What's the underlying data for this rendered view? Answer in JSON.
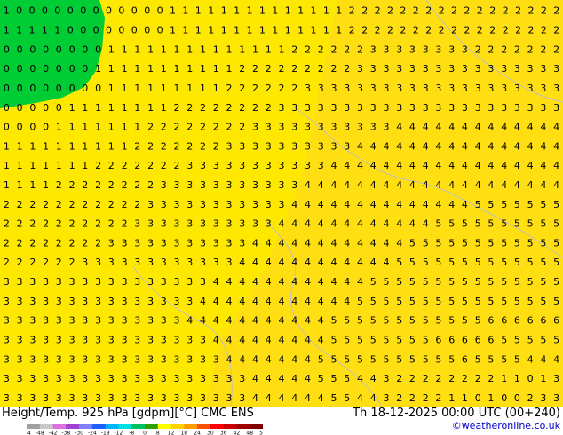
{
  "footer": {
    "title": "Height/Temp. 925 hPa [gdpm][°C] CMC ENS",
    "datetime": "Th 18-12-2025 00:00 UTC (00+240)",
    "credit": "©weatheronline.co.uk"
  },
  "legend": {
    "ticks": [
      "-54",
      "-48",
      "-42",
      "-38",
      "-30",
      "-24",
      "-18",
      "-12",
      "-8",
      "0",
      "8",
      "12",
      "18",
      "24",
      "30",
      "36",
      "42",
      "48",
      "54"
    ],
    "colors": [
      "#a0a0a0",
      "#c8c8c8",
      "#e070e0",
      "#a040d0",
      "#8080ff",
      "#2060ff",
      "#00b4ff",
      "#00e0e0",
      "#00c060",
      "#30a000",
      "#ffff00",
      "#ffd200",
      "#ff9a00",
      "#ff5000",
      "#ff0000",
      "#c80000",
      "#a00000",
      "#800000"
    ]
  },
  "map": {
    "colors": {
      "warm": "#ffe800",
      "warmer": "#ffdc1a",
      "cold": "#00cc33",
      "coast": "#c0c0c0"
    },
    "rows": [
      "1 0 0 0 0 0 0 0 0 0 0 0 0 1 1 1 1 1 1 1 1 1 1 1 1 1 1 2 2 2 2 2 2 2 2 2 2 2 2 2 2 2 2 2",
      "1 1 1 1 1 0 0 0 0 0 0 0 0 1 1 1 1 1 1 1 1 1 1 1 1 1 1 2 2 2 2 2 2 2 2 2 2 2 2 2 2 2 2 2",
      "0 0 0 0 0 0 0 0 1 1 1 1 1 1 1 1 1 1 1 1 1 1 2 2 2 2 2 2 3 3 3 3 3 3 3 3 2 2 2 2 2 2 2",
      "0 0 0 0 0 0 0 1 1 1 1 1 1 1 1 1 1 1 2 2 2 2 2 2 2 2 2 3 3 3 3 3 3 3 3 3 3 3 3 3 3 3 3",
      "0 0 0 0 0 0 0 0 1 1 1 1 1 1 1 1 1 2 2 2 2 2 2 3 3 3 3 3 3 3 3 3 3 3 3 3 3 3 3 3 3 3 3",
      "0 0 0 0 0 1 1 1 1 1 1 1 1 2 2 2 2 2 2 2 2 3 3 3 3 3 3 3 3 3 3 3 3 3 3 3 3 3 3 3 3 3 3",
      "0 0 0 0 1 1 1 1 1 1 1 2 2 2 2 2 2 2 2 3 3 3 3 3 3 3 3 3 3 3 4 4 4 4 4 4 4 4 4 4 4 4 4",
      "1 1 1 1 1 1 1 1 1 1 2 2 2 2 2 2 2 3 3 3 3 3 3 3 3 3 3 4 4 4 4 4 4 4 4 4 4 4 4 4 4 4 4",
      "1 1 1 1 1 1 1 2 2 2 2 2 2 2 3 3 3 3 3 3 3 3 3 3 3 4 4 4 4 4 4 4 4 4 4 4 4 4 4 4 4 4 4",
      "1 1 1 1 2 2 2 2 2 2 2 2 3 3 3 3 3 3 3 3 3 3 3 4 4 4 4 4 4 4 4 4 4 4 4 4 4 4 4 4 4 4 4",
      "2 2 2 2 2 2 2 2 2 2 2 3 3 3 3 3 3 3 3 3 3 3 4 4 4 4 4 4 4 4 4 4 4 4 4 4 5 5 5 5 5 5 5",
      "2 2 2 2 2 2 2 2 2 2 3 3 3 3 3 3 3 3 3 3 3 4 4 4 4 4 4 4 4 4 4 4 4 5 5 5 5 5 5 5 5 5 5",
      "2 2 2 2 2 2 2 2 3 3 3 3 3 3 3 3 3 3 3 4 4 4 4 4 4 4 4 4 4 4 4 5 5 5 5 5 5 5 5 5 5 5 5",
      "2 2 2 2 2 2 3 3 3 3 3 3 3 3 3 3 3 3 4 4 4 4 4 4 4 4 4 4 4 4 5 5 5 5 5 5 5 5 5 5 5 5 5",
      "3 3 3 3 3 3 3 3 3 3 3 3 3 3 3 3 4 4 4 4 4 4 4 4 4 4 4 4 5 5 5 5 5 5 5 5 5 5 5 5 5 5 5",
      "3 3 3 3 3 3 3 3 3 3 3 3 3 3 3 4 4 4 4 4 4 4 4 4 4 4 4 5 5 5 5 5 5 5 5 5 5 5 5 5 5 5 5",
      "3 3 3 3 3 3 3 3 3 3 3 3 3 3 4 4 4 4 4 4 4 4 4 4 4 5 5 5 5 5 5 5 5 5 5 5 5 6 6 6 6 6 6",
      "3 3 3 3 3 3 3 3 3 3 3 3 3 3 3 3 4 4 4 4 4 4 4 4 4 5 5 5 5 5 5 5 5 6 6 6 6 6 5 5 5 5 5",
      "3 3 3 3 3 3 3 3 3 3 3 3 3 3 3 3 3 4 4 4 4 4 4 4 5 5 5 5 5 5 5 5 5 5 5 6 5 5 5 5 4 4 4",
      "3 3 3 3 3 3 3 3 3 3 3 3 3 3 3 3 3 3 3 4 4 4 4 4 5 5 5 4 4 3 2 2 2 2 2 2 2 2 1 1 0 1 3",
      "3 3 3 3 3 3 3 3 3 3 3 3 3 3 3 3 3 3 3 4 4 4 4 4 4 5 5 4 4 3 2 2 2 2 1 1 0 1 0 0 2 3 3"
    ]
  }
}
